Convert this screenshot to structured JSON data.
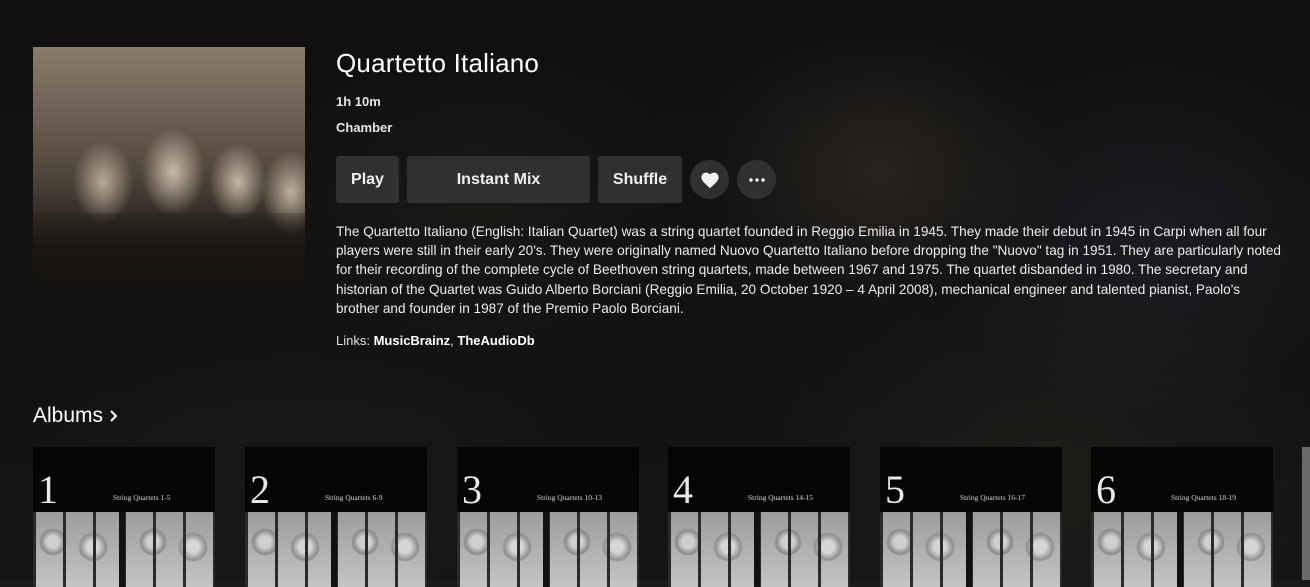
{
  "artist": {
    "name": "Quartetto Italiano",
    "duration": "1h 10m",
    "genre": "Chamber"
  },
  "actions": {
    "play": "Play",
    "instant_mix": "Instant Mix",
    "shuffle": "Shuffle",
    "favorite_icon": "heart-icon",
    "more_icon": "more-horizontal-icon"
  },
  "overview": "The Quartetto Italiano (English: Italian Quartet) was a string quartet founded in Reggio Emilia in 1945. They made their debut in 1945 in Carpi when all four players were still in their early 20's. They were originally named Nuovo Quartetto Italiano before dropping the \"Nuovo\" tag in 1951. They are particularly noted for their recording of the complete cycle of Beethoven string quartets, made between 1967 and 1975. The quartet disbanded in 1980. The secretary and historian of the Quartet was Guido Alberto Borciani (Reggio Emilia, 20 October 1920 – 4 April 2008), mechanical engineer and talented pianist, Paolo's brother and founder in 1987 of the Premio Paolo Borciani.",
  "links": {
    "prefix": "Links:",
    "items": [
      "MusicBrainz",
      "TheAudioDb"
    ],
    "separator": ","
  },
  "albums": {
    "title": "Albums",
    "items": [
      {
        "number": "1",
        "subtitle": "String Quartets 1-5"
      },
      {
        "number": "2",
        "subtitle": "String Quartets 6-9"
      },
      {
        "number": "3",
        "subtitle": "String Quartets 10-13"
      },
      {
        "number": "4",
        "subtitle": "String Quartets 14-15"
      },
      {
        "number": "5",
        "subtitle": "String Quartets 16-17"
      },
      {
        "number": "6",
        "subtitle": "String Quartets 18-19"
      }
    ]
  }
}
